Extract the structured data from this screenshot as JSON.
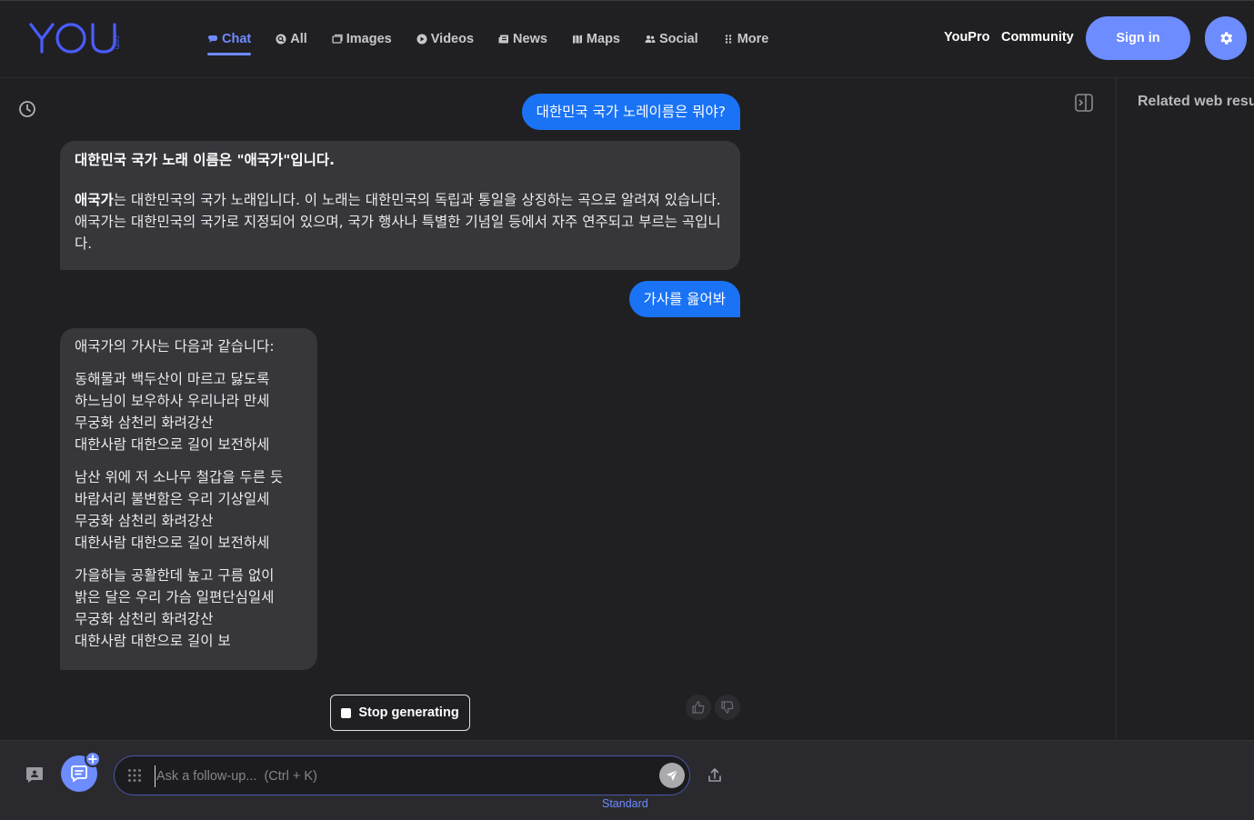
{
  "header": {
    "logo_text": "YOU",
    "logo_suffix": ".com",
    "nav": [
      {
        "label": "Chat",
        "icon": "chat-icon",
        "active": true
      },
      {
        "label": "All",
        "icon": "search-icon",
        "active": false
      },
      {
        "label": "Images",
        "icon": "images-icon",
        "active": false
      },
      {
        "label": "Videos",
        "icon": "play-icon",
        "active": false
      },
      {
        "label": "News",
        "icon": "news-icon",
        "active": false
      },
      {
        "label": "Maps",
        "icon": "map-icon",
        "active": false
      },
      {
        "label": "Social",
        "icon": "people-icon",
        "active": false
      },
      {
        "label": "More",
        "icon": "dots-grid-icon",
        "active": false
      }
    ],
    "youpro_label": "YouPro",
    "community_label": "Community",
    "signin_label": "Sign in"
  },
  "sidebar_right": {
    "title": "Related web resu"
  },
  "conversation": {
    "user_msg_1": "대한민국 국가 노레이름은 뭐야?",
    "bot_msg_1": {
      "heading": "대한민국 국가 노래 이름은 \"애국가\"입니다.",
      "bold_term": "애국가",
      "body": "는 대한민국의 국가 노래입니다. 이 노래는 대한민국의 독립과 통일을 상징하는 곡으로 알려져 있습니다. 애국가는 대한민국의 국가로 지정되어 있으며, 국가 행사나 특별한 기념일 등에서 자주 연주되고 부르는 곡입니다."
    },
    "user_msg_2": "가사를 읊어봐",
    "bot_msg_2": {
      "intro": "애국가의 가사는 다음과 같습니다:",
      "verse1": [
        "동해물과 백두산이 마르고 닳도록",
        "하느님이 보우하사 우리나라 만세",
        "무궁화 삼천리 화려강산",
        "대한사람 대한으로 길이 보전하세"
      ],
      "verse2": [
        "남산 위에 저 소나무 철갑을 두른 듯",
        "바람서리 불변함은 우리 기상일세",
        "무궁화 삼천리 화려강산",
        "대한사람 대한으로 길이 보전하세"
      ],
      "verse3": [
        "가을하늘 공활한데 높고 구름 없이",
        "밝은 달은 우리 가슴 일편단심일세",
        "무궁화 삼천리 화려강산",
        "대한사람 대한으로 길이 보"
      ]
    },
    "stop_label": "Stop generating"
  },
  "composer": {
    "placeholder": "Ask a follow-up...  (Ctrl + K)",
    "value": "",
    "mode": "Standard"
  },
  "colors": {
    "accent": "#6c8cff",
    "user_bubble": "#1a73f5",
    "bot_bubble": "#36363b",
    "background": "#202023"
  }
}
